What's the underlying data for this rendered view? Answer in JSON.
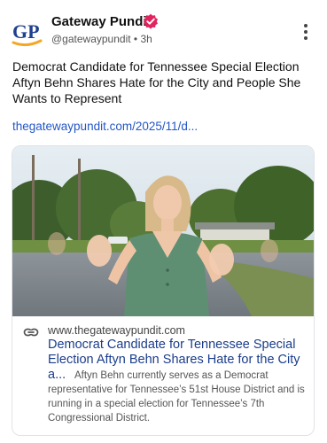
{
  "post": {
    "author_name": "Gateway Pundit",
    "avatar_text": "GP",
    "handle": "@gatewaypundit",
    "separator": "•",
    "time": "3h",
    "text": "Democrat Candidate for Tennessee Special Election Aftyn Behn Shares Hate for the City and People She Wants to Represent",
    "link": "thegatewaypundit.com/2025/11/d..."
  },
  "card": {
    "domain": "www.thegatewaypundit.com",
    "title": "Democrat Candidate for Tennessee Special Election Aftyn Behn Shares Hate for the City a...",
    "description": "Aftyn Behn currently serves as a Democrat representative for Tennessee’s 51st House District and is running in a special election for Tennessee’s 7th Congressional District."
  },
  "icons": {
    "verified": "verified-badge-icon",
    "more": "more-vertical-icon",
    "link": "link-icon"
  },
  "colors": {
    "verified": "#e0245e",
    "link": "#2457c5",
    "card_title": "#1a3d8c",
    "avatar_blue": "#1f3f8f",
    "avatar_orange": "#f5a623"
  }
}
